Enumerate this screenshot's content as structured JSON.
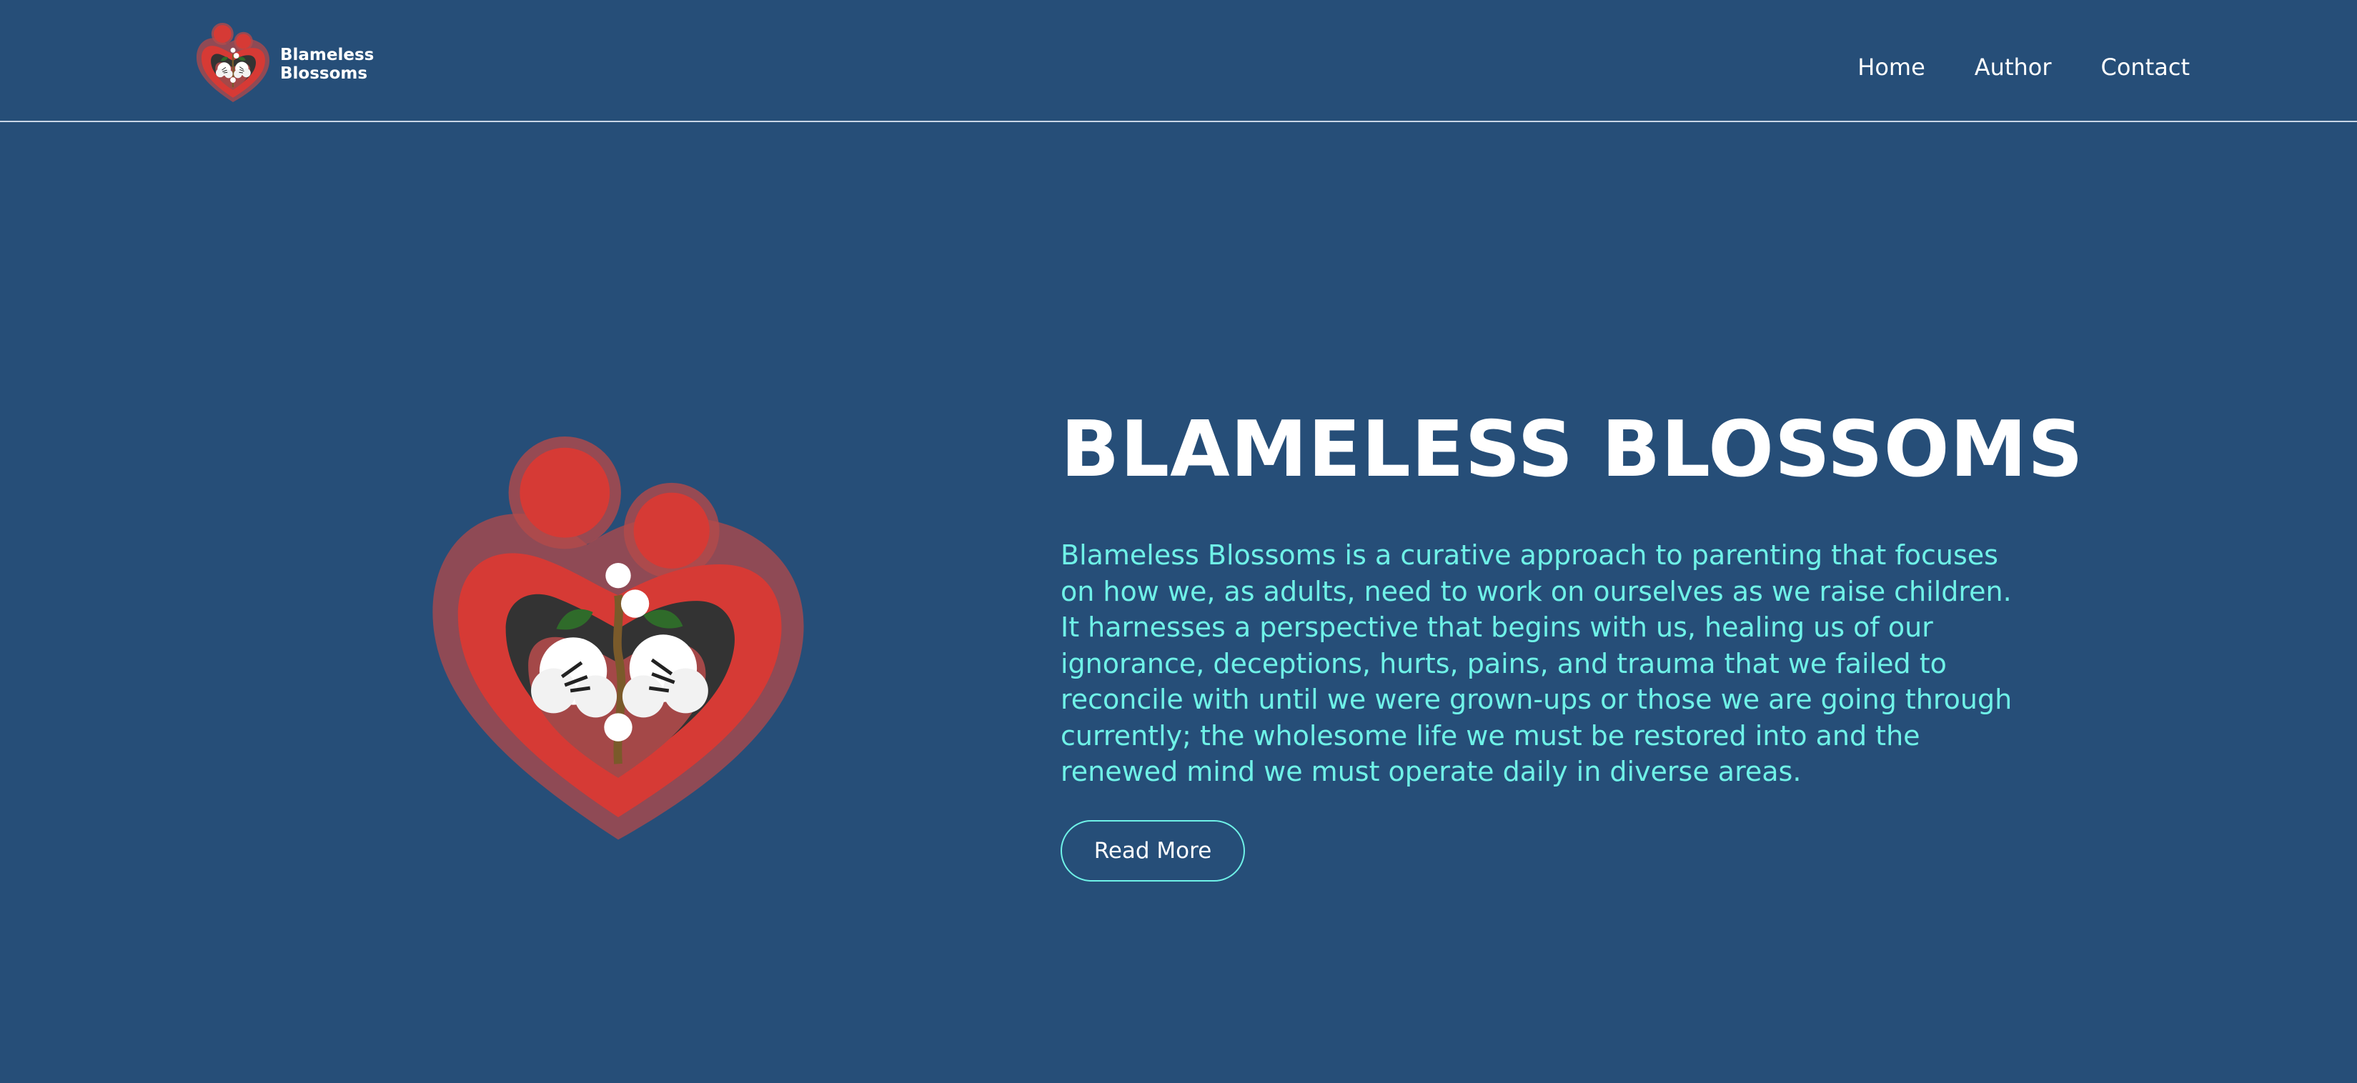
{
  "header": {
    "brand": {
      "line1": "Blameless",
      "line2": "Blossoms"
    },
    "nav": [
      {
        "label": "Home"
      },
      {
        "label": "Author"
      },
      {
        "label": "Contact"
      }
    ]
  },
  "hero": {
    "title": "BLAMELESS BLOSSOMS",
    "description": "Blameless Blossoms is a curative approach to parenting that focuses on how we, as adults, need to work on ourselves as we raise children. It harnesses a perspective that begins with us, healing us of our ignorance, deceptions, hurts, pains, and trauma that we failed to reconcile with until we were grown-ups or those we are going through currently; the wholesome life we must be restored into and the renewed mind we must operate daily in diverse areas.",
    "button_label": "Read More"
  },
  "colors": {
    "background": "#264e78",
    "accent": "#6ff2e8",
    "logo_red": "#d63a35",
    "text": "#ffffff"
  }
}
